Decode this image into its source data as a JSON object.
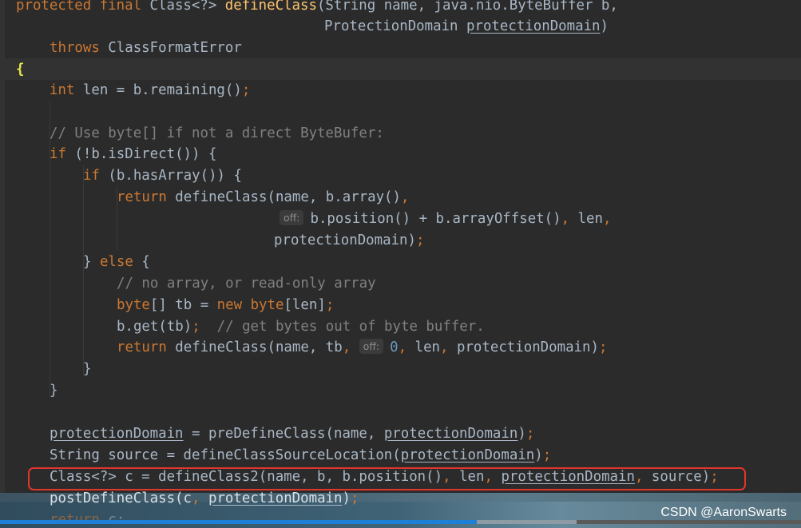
{
  "code": {
    "l1": {
      "kw": "protected final",
      "t1": " Class<?> ",
      "fn": "defineClass",
      "t2": "(String name, java.nio.ByteBuffer b,"
    },
    "l2": {
      "t1": "ProtectionDomain ",
      "u": "protectionDomain",
      "t2": ")"
    },
    "l3": {
      "kw": "throws",
      "t1": " ClassFormatError"
    },
    "l4": {
      "brace": "{"
    },
    "l5": {
      "kw": "int",
      "t1": " len = b.remaining()",
      "semi": ";"
    },
    "l6": {
      "cm": "// Use byte[] if not a direct ByteBufer:"
    },
    "l7": {
      "kw": "if",
      "t1": " (!b.isDirect()) {"
    },
    "l8": {
      "kw": "if",
      "t1": " (b.hasArray()) {"
    },
    "l9": {
      "kw": "return",
      "t1": " defineClass(name, b.array()",
      "comma": ","
    },
    "l10": {
      "hint": "off:",
      "t1": "b.position() + b.arrayOffset()",
      "c1": ",",
      "t2": " len",
      "c2": ","
    },
    "l11": {
      "t1": "protectionDomain)",
      "semi": ";"
    },
    "l12": {
      "t1": "} ",
      "kw": "else",
      "t2": " {"
    },
    "l13": {
      "cm": "// no array, or read-only array"
    },
    "l14": {
      "kw1": "byte",
      "t1": "[] tb = ",
      "kw2": "new",
      "sp": " ",
      "kw3": "byte",
      "t2": "[len]",
      "semi": ";"
    },
    "l15": {
      "t1": "b.get(tb)",
      "semi": ";",
      "cm": "  // get bytes out of byte buffer."
    },
    "l16": {
      "kw": "return",
      "t1": " defineClass(name, tb",
      "c1": ",",
      "hint": "off:",
      "num": "0",
      "c2": ",",
      "t2": " len",
      "c3": ",",
      "t3": " protectionDomain)",
      "semi": ";"
    },
    "l17": {
      "t1": "}"
    },
    "l18": {
      "t1": "}"
    },
    "l19": {
      "u1": "protectionDomain",
      "t1": " = preDefineClass(name, ",
      "u2": "protectionDomain",
      "t2": ")",
      "semi": ";"
    },
    "l20": {
      "t1": "String source = defineClassSourceLocation(",
      "u": "protectionDomain",
      "t2": ")",
      "semi": ";"
    },
    "l21": {
      "t1": "Class<?> c = defineClass2(name, b, b.position()",
      "c1": ",",
      "t2": " len",
      "c2": ",",
      "u": "protectionDomain",
      "c3": ",",
      "t3": " source)",
      "semi": ";"
    },
    "l22": {
      "t1": "postDefineClass(c",
      "c1": ",",
      "u": "protectionDomain",
      "t2": ")",
      "semi": ";"
    },
    "l23": {
      "kw": "return",
      "t1": " c;"
    }
  },
  "watermark": "CSDN @AaronSwarts",
  "player": {
    "progress": 0.595,
    "buffered": 0.72
  },
  "colors": {
    "keyword": "#cc7832",
    "function": "#ffc66d",
    "comment": "#808080",
    "number": "#6897bb",
    "text": "#a9b7c6",
    "highlight": "#e0362c"
  }
}
